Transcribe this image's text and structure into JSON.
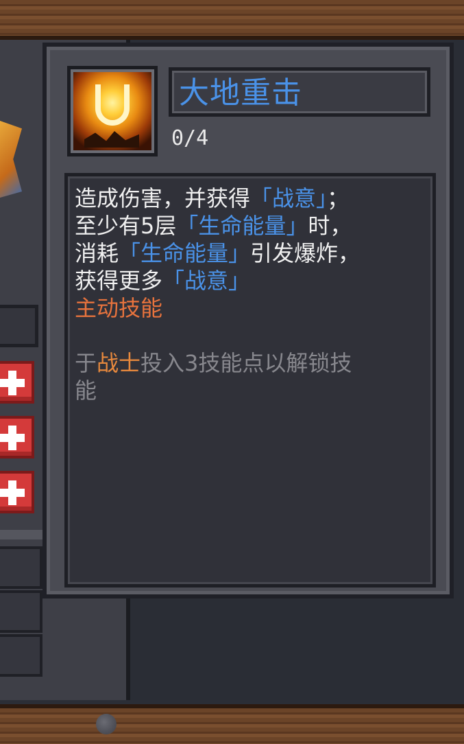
{
  "skill": {
    "name": "大地重击",
    "level": "0/4",
    "icon": "earth-slam-icon"
  },
  "description": {
    "line1": {
      "a": "造成伤害，并获得",
      "b": "「战意」",
      "c": "；"
    },
    "line2": {
      "a": "至少有5层",
      "b": "「生命能量」",
      "c": "时，"
    },
    "line3": {
      "a": "消耗",
      "b": "「生命能量」",
      "c": "引发爆炸，"
    },
    "line4": {
      "a": "获得更多",
      "b": "「战意」"
    },
    "type": "主动技能",
    "unlock": {
      "prefix": "于",
      "class_name": "战士",
      "suffix": "投入3技能点以解锁技",
      "suffix2": "能"
    }
  },
  "colors": {
    "keyword": "#4a92e8",
    "active_skill": "#e8733d",
    "class_name": "#e8893d",
    "unlock_text": "#88888e",
    "plus_button": "#d43a3a"
  }
}
